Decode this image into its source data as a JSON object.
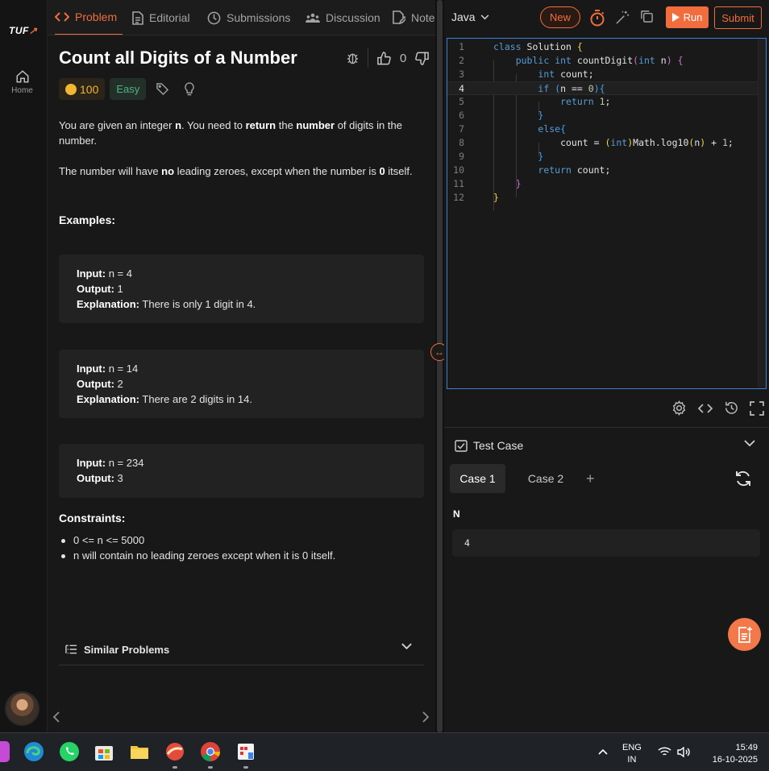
{
  "brand": {
    "logo": "TUF"
  },
  "rail": {
    "home_label": "Home"
  },
  "tabs": [
    {
      "label": "Problem",
      "icon": "code-icon"
    },
    {
      "label": "Editorial",
      "icon": "document-icon"
    },
    {
      "label": "Submissions",
      "icon": "clock-icon"
    },
    {
      "label": "Discussion",
      "icon": "people-icon"
    },
    {
      "label": "Notes",
      "icon": "note-edit-icon"
    }
  ],
  "problem": {
    "title": "Count all Digits of a Number",
    "likes": "0",
    "coins": "100",
    "difficulty": "Easy",
    "desc1": {
      "a": "You are given an integer ",
      "b": "n",
      "c": ". You need to ",
      "d": "return",
      "e": " the ",
      "f": "number",
      "g": " of digits in the number."
    },
    "desc2": {
      "a": "The number will have ",
      "b": "no",
      "c": " leading zeroes, except when the number is ",
      "d": "0",
      "e": " itself."
    },
    "examples_heading": "Examples:",
    "examples": [
      {
        "input": " n = 4",
        "output": " 1",
        "explanation": " There is only 1 digit in 4."
      },
      {
        "input": " n = 14",
        "output": " 2",
        "explanation": " There are 2 digits in 14."
      },
      {
        "input": " n = 234",
        "output": " 3"
      }
    ],
    "labels": {
      "input": "Input:",
      "output": "Output:",
      "explanation": "Explanation:"
    },
    "constraints_heading": "Constraints:",
    "constraints": [
      "0 <= n <= 5000",
      "n will contain no leading zeroes except when it is 0 itself."
    ],
    "similar_label": "Similar Problems"
  },
  "editor": {
    "language": "Java",
    "new_label": "New",
    "run_label": "Run",
    "submit_label": "Submit",
    "current_line": 4,
    "lines": [
      {
        "n": "1"
      },
      {
        "n": "2"
      },
      {
        "n": "3"
      },
      {
        "n": "4"
      },
      {
        "n": "5"
      },
      {
        "n": "6"
      },
      {
        "n": "7"
      },
      {
        "n": "8"
      },
      {
        "n": "9"
      },
      {
        "n": "10"
      },
      {
        "n": "11"
      },
      {
        "n": "12"
      }
    ]
  },
  "testcase": {
    "heading": "Test Case",
    "cases": [
      "Case 1",
      "Case 2"
    ],
    "active_case": "Case 1",
    "var_name": "N",
    "var_value": "4"
  },
  "taskbar": {
    "lang_line1": "ENG",
    "lang_line2": "IN",
    "time": "15:49",
    "date": "16-10-2025"
  },
  "colors": {
    "accent": "#f26d3d",
    "easy": "#4fb37d",
    "coin": "#f2b632",
    "editor_border": "#3b7fd8"
  }
}
